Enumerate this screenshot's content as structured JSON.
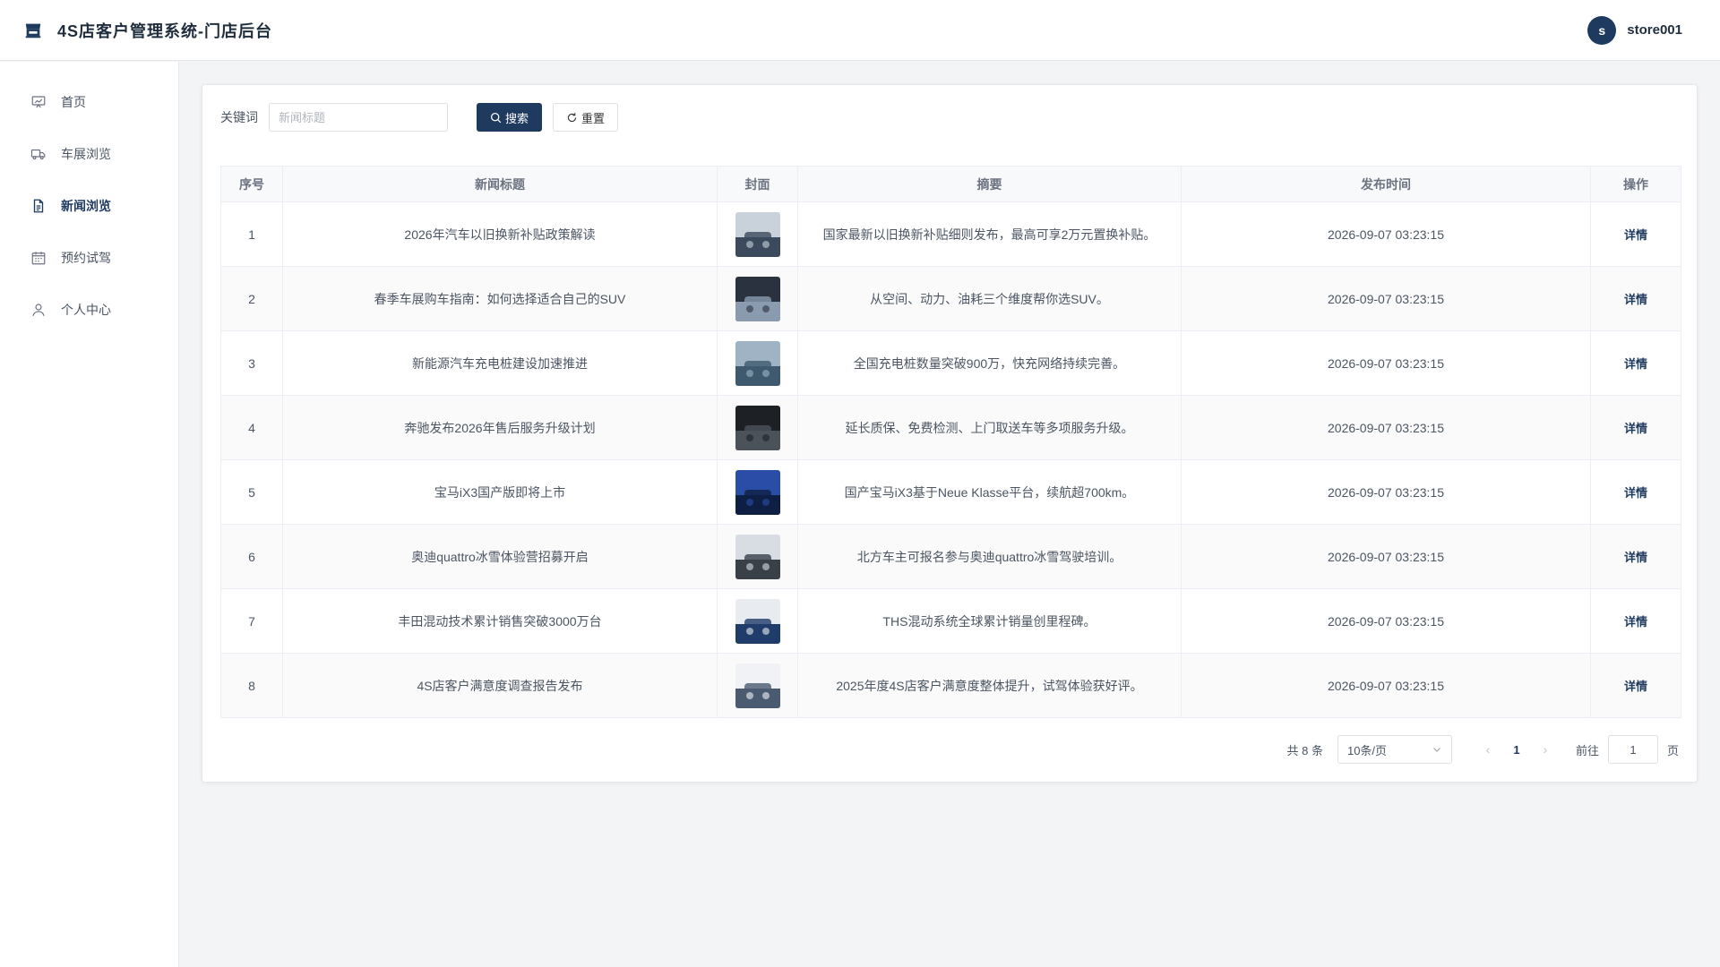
{
  "header": {
    "app_title": "4S店客户管理系统-门店后台",
    "avatar_letter": "s",
    "username": "store001"
  },
  "sidebar": {
    "items": [
      {
        "label": "首页",
        "icon": "chart-board-icon"
      },
      {
        "label": "车展浏览",
        "icon": "truck-icon"
      },
      {
        "label": "新闻浏览",
        "icon": "document-icon",
        "active": true
      },
      {
        "label": "预约试驾",
        "icon": "calendar-icon"
      },
      {
        "label": "个人中心",
        "icon": "user-icon"
      }
    ]
  },
  "search": {
    "label": "关键词",
    "placeholder": "新闻标题",
    "value": "",
    "search_button": "搜索",
    "reset_button": "重置"
  },
  "table": {
    "columns": [
      "序号",
      "新闻标题",
      "封面",
      "摘要",
      "发布时间",
      "操作"
    ],
    "rows": [
      {
        "index": "1",
        "title": "2026年汽车以旧换新补贴政策解读",
        "summary": "国家最新以旧换新补贴细则发布，最高可享2万元置换补贴。",
        "time": "2026-09-07 03:23:15",
        "action": "详情",
        "thumb_colors": [
          "#c9d2db",
          "#3b4a5c"
        ]
      },
      {
        "index": "2",
        "title": "春季车展购车指南：如何选择适合自己的SUV",
        "summary": "从空间、动力、油耗三个维度帮你选SUV。",
        "time": "2026-09-07 03:23:15",
        "action": "详情",
        "thumb_colors": [
          "#2a3240",
          "#8a9bb0"
        ]
      },
      {
        "index": "3",
        "title": "新能源汽车充电桩建设加速推进",
        "summary": "全国充电桩数量突破900万，快充网络持续完善。",
        "time": "2026-09-07 03:23:15",
        "action": "详情",
        "thumb_colors": [
          "#9fb3c4",
          "#3f5a6e"
        ]
      },
      {
        "index": "4",
        "title": "奔驰发布2026年售后服务升级计划",
        "summary": "延长质保、免费检测、上门取送车等多项服务升级。",
        "time": "2026-09-07 03:23:15",
        "action": "详情",
        "thumb_colors": [
          "#1d2024",
          "#4c525a"
        ]
      },
      {
        "index": "5",
        "title": "宝马iX3国产版即将上市",
        "summary": "国产宝马iX3基于Neue Klasse平台，续航超700km。",
        "time": "2026-09-07 03:23:15",
        "action": "详情",
        "thumb_colors": [
          "#2a4ea8",
          "#0f1f44"
        ]
      },
      {
        "index": "6",
        "title": "奥迪quattro冰雪体验营招募开启",
        "summary": "北方车主可报名参与奥迪quattro冰雪驾驶培训。",
        "time": "2026-09-07 03:23:15",
        "action": "详情",
        "thumb_colors": [
          "#d8dde3",
          "#3a4048"
        ]
      },
      {
        "index": "7",
        "title": "丰田混动技术累计销售突破3000万台",
        "summary": "THS混动系统全球累计销量创里程碑。",
        "time": "2026-09-07 03:23:15",
        "action": "详情",
        "thumb_colors": [
          "#e8ecf0",
          "#1f3c6a"
        ]
      },
      {
        "index": "8",
        "title": "4S店客户满意度调查报告发布",
        "summary": "2025年度4S店客户满意度整体提升，试驾体验获好评。",
        "time": "2026-09-07 03:23:15",
        "action": "详情",
        "thumb_colors": [
          "#f0f2f5",
          "#4a5a70"
        ]
      }
    ]
  },
  "pagination": {
    "total_text": "共 8 条",
    "page_size": "10条/页",
    "current_page": "1",
    "goto_label": "前往",
    "goto_value": "1",
    "goto_suffix": "页"
  },
  "colors": {
    "primary": "#1e3a5f",
    "border": "#ebeef5",
    "background": "#f3f4f6"
  }
}
